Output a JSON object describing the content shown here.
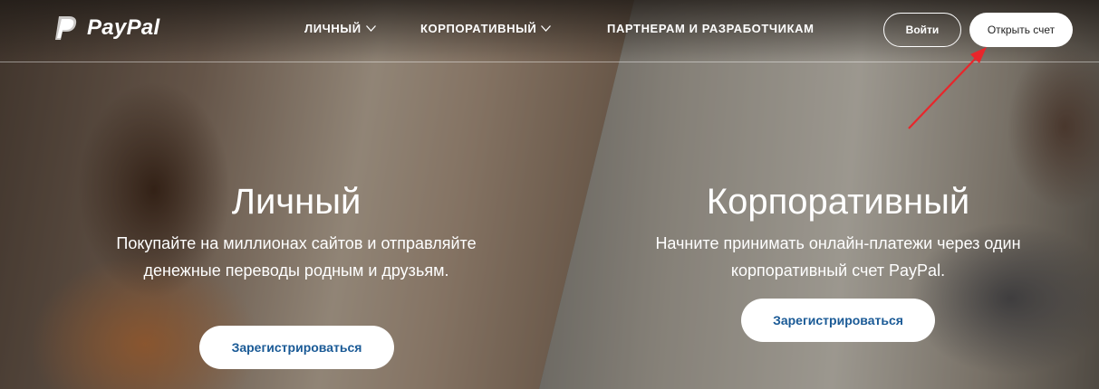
{
  "brand": {
    "name": "PayPal"
  },
  "nav": {
    "items": [
      {
        "label": "ЛИЧНЫЙ",
        "icon": "chevron-down-icon"
      },
      {
        "label": "КОРПОРАТИВНЫЙ",
        "icon": "chevron-down-icon"
      },
      {
        "label": "ПАРТНЕРАМ И РАЗРАБОТЧИКАМ"
      }
    ],
    "login_label": "Войти",
    "signup_label": "Открыть счет"
  },
  "personal": {
    "title": "Личный",
    "description": "Покупайте на миллионах сайтов и отправляйте денежные переводы родным и друзьям.",
    "button_label": "Зарегистрироваться"
  },
  "business": {
    "title": "Корпоративный",
    "description": "Начните принимать онлайн-платежи через один корпоративный счет PayPal.",
    "button_label": "Зарегистрироваться"
  },
  "colors": {
    "button_text": "#1a5a96",
    "annotation_arrow": "#e8262b"
  }
}
